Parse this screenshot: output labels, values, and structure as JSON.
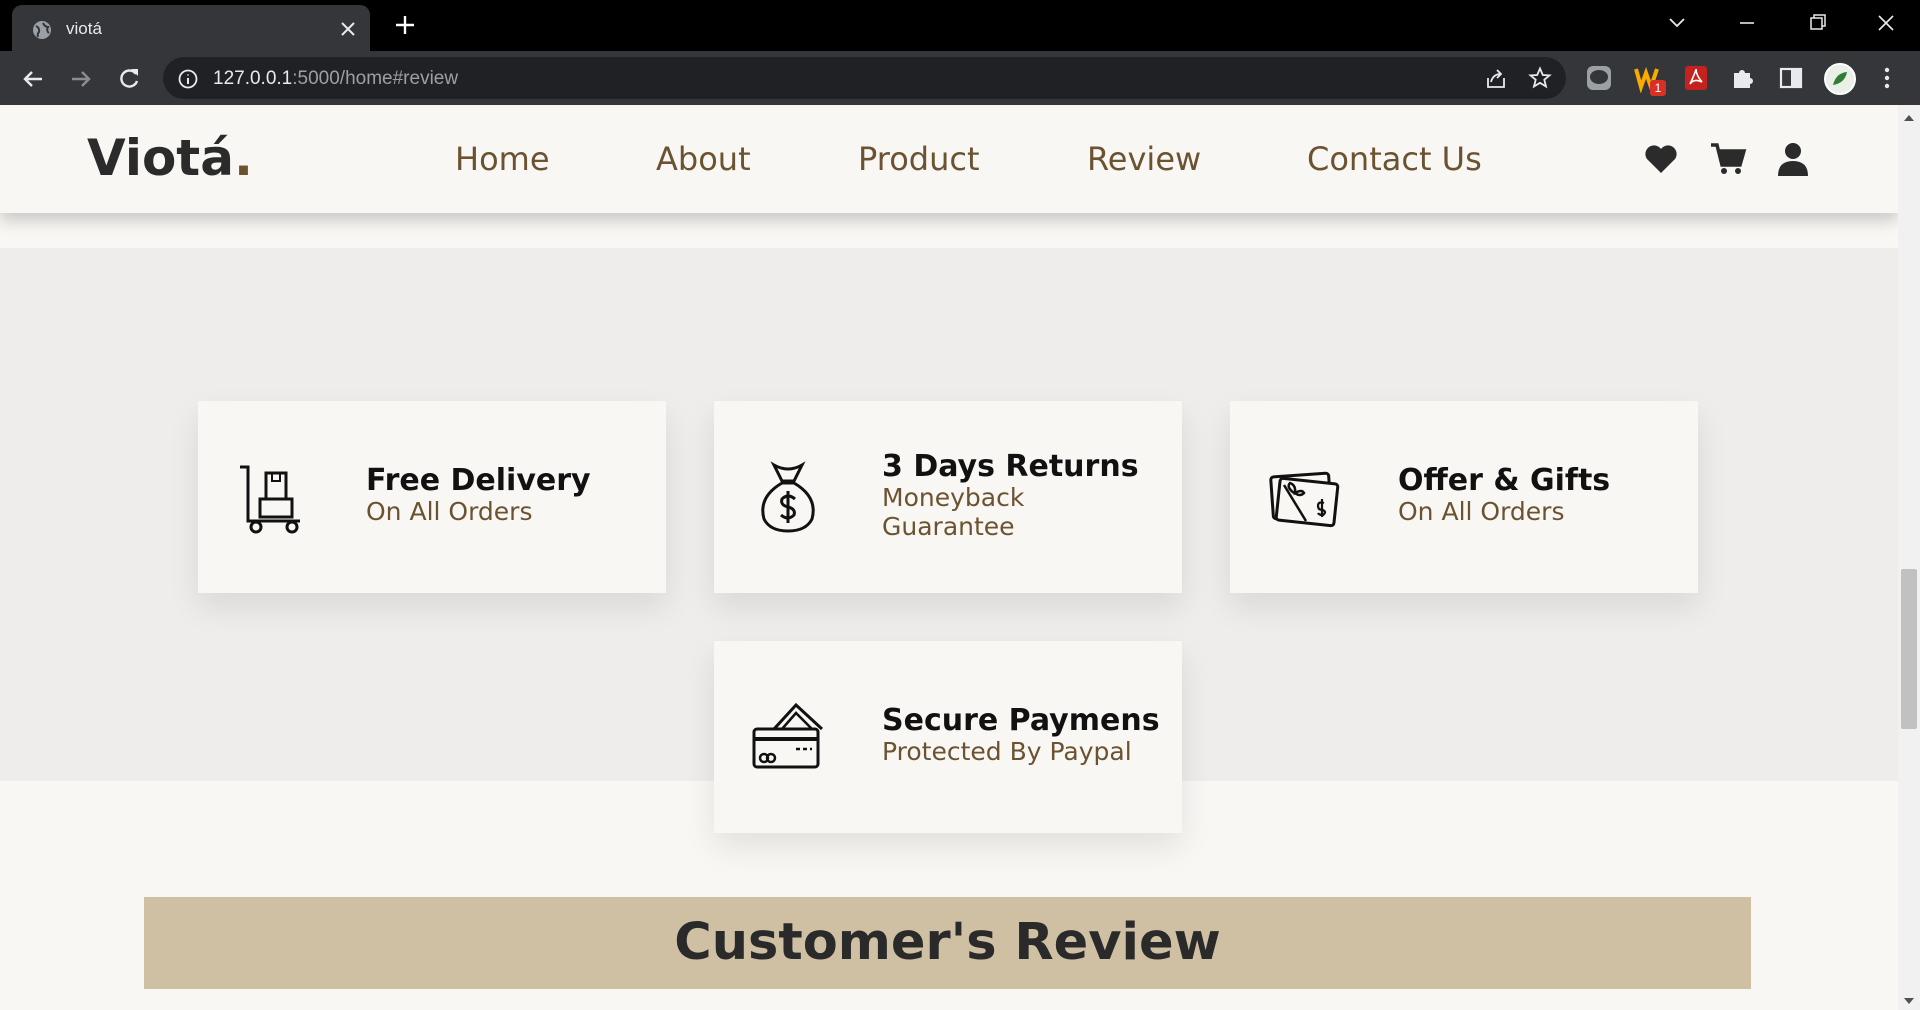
{
  "browser": {
    "tab_title": "viotá",
    "url_host": "127.0.0.1",
    "url_rest": ":5000/home#review",
    "extension_badge": "1"
  },
  "nav": {
    "logo": "Viotá",
    "logo_dot": ".",
    "links": [
      "Home",
      "About",
      "Product",
      "Review",
      "Contact Us"
    ],
    "icons": [
      "heart-icon",
      "cart-icon",
      "user-icon"
    ]
  },
  "features": [
    {
      "title": "Free Delivery",
      "subtitle": "On All Orders",
      "icon": "delivery-cart-icon"
    },
    {
      "title": "3 Days Returns",
      "subtitle": "Moneyback Guarantee",
      "icon": "money-bag-icon"
    },
    {
      "title": "Offer & Gifts",
      "subtitle": "On All Orders",
      "icon": "gift-card-icon"
    },
    {
      "title": "Secure Paymens",
      "subtitle": "Protected By Paypal",
      "icon": "credit-card-icon"
    }
  ],
  "review": {
    "title": "Customer's Review"
  },
  "colors": {
    "accent": "#6b5331",
    "review_band": "#cfbfa3",
    "section_bg": "#eeedeb",
    "page_bg": "#f8f7f4"
  }
}
